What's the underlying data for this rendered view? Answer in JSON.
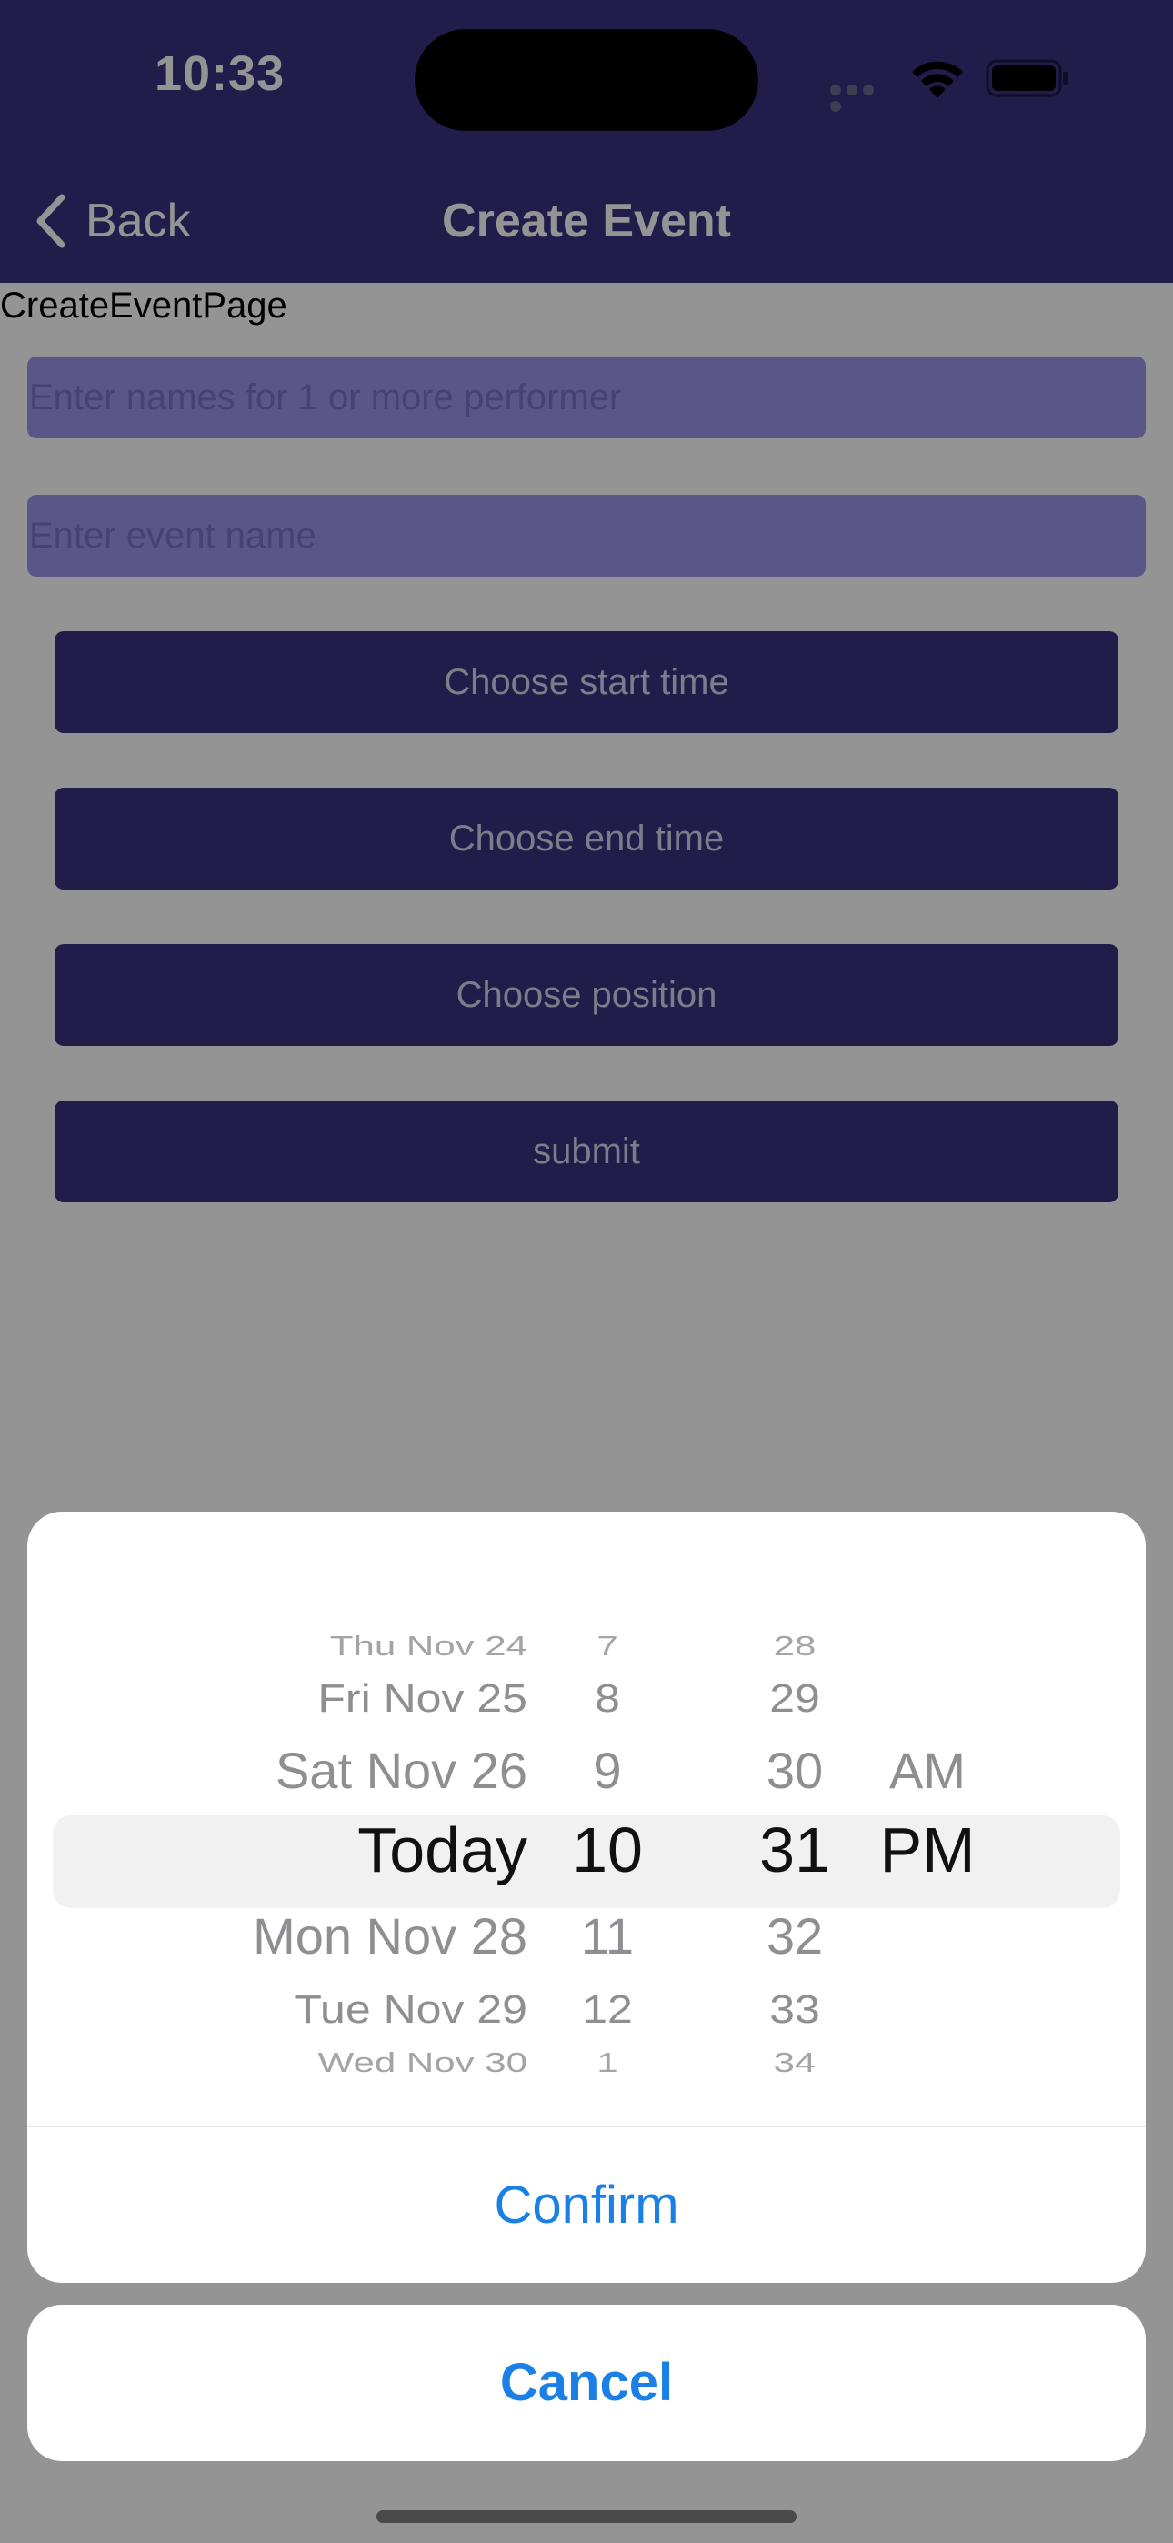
{
  "status_bar": {
    "time": "10:33"
  },
  "nav": {
    "back_label": "Back",
    "title": "Create Event"
  },
  "page": {
    "label": "CreateEventPage",
    "performers_placeholder": "Enter names for 1 or more performer",
    "event_name_placeholder": "Enter event name",
    "buttons": {
      "start_time": "Choose start time",
      "end_time": "Choose end time",
      "position": "Choose position",
      "submit": "submit"
    }
  },
  "picker": {
    "dates": [
      "Thu Nov 24",
      "Fri Nov 25",
      "Sat Nov 26",
      "Today",
      "Mon Nov 28",
      "Tue Nov 29",
      "Wed Nov 30"
    ],
    "hours": [
      "7",
      "8",
      "9",
      "10",
      "11",
      "12",
      "1"
    ],
    "minutes": [
      "28",
      "29",
      "30",
      "31",
      "32",
      "33",
      "34"
    ],
    "ampm": [
      "AM",
      "PM"
    ],
    "selected": {
      "date": "Today",
      "hour": "10",
      "minute": "31",
      "ampm": "PM"
    }
  },
  "sheet": {
    "confirm_label": "Confirm",
    "cancel_label": "Cancel"
  },
  "colors": {
    "nav_background": "#3a317f",
    "input_background": "#9b95ea",
    "button_background": "#3a317f",
    "action_text": "#1a80e6"
  }
}
